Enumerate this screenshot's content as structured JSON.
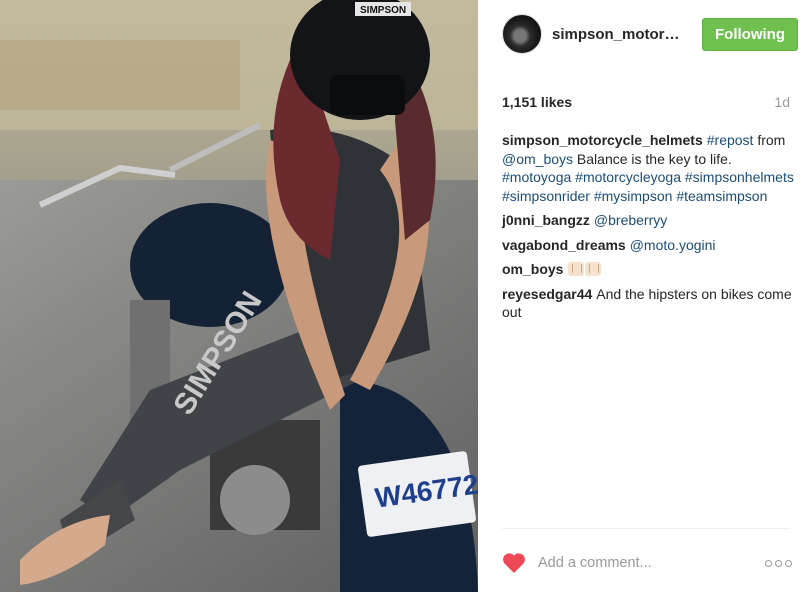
{
  "post": {
    "username": "simpson_motorc...",
    "follow_label": "Following",
    "likes": "1,151 likes",
    "age": "1d",
    "photo_lettering": {
      "helmet_brand": "SIMPSON",
      "plate_number": "W46772"
    }
  },
  "comments": [
    {
      "user": "simpson_motorcycle_helmets",
      "parts": [
        {
          "text": "#repost",
          "link": true
        },
        {
          "text": " from ",
          "link": false
        },
        {
          "text": "@om_boys",
          "link": true
        },
        {
          "text": " Balance is the key to life. ",
          "link": false
        },
        {
          "text": "#motoyoga",
          "link": true
        },
        {
          "text": " ",
          "link": false
        },
        {
          "text": "#motorcycleyoga",
          "link": true
        },
        {
          "text": " ",
          "link": false
        },
        {
          "text": "#simpsonhelmets",
          "link": true
        },
        {
          "text": " ",
          "link": false
        },
        {
          "text": "#simpsonrider",
          "link": true
        },
        {
          "text": " ",
          "link": false
        },
        {
          "text": "#mysimpson",
          "link": true
        },
        {
          "text": " ",
          "link": false
        },
        {
          "text": "#teamsimpson",
          "link": true
        }
      ]
    },
    {
      "user": "j0nni_bangzz",
      "parts": [
        {
          "text": "@breberryy",
          "link": true
        }
      ]
    },
    {
      "user": "vagabond_dreams",
      "parts": [
        {
          "text": "@moto.yogini",
          "link": true
        }
      ]
    },
    {
      "user": "om_boys",
      "parts": [],
      "emoji_count": 2
    },
    {
      "user": "reyesedgar44",
      "parts": [
        {
          "text": "And the hipsters on bikes come out",
          "link": false
        }
      ]
    }
  ],
  "footer": {
    "add_comment_placeholder": "Add a comment...",
    "heart_icon": "heart-icon",
    "more_icon": "more-options-icon"
  },
  "colors": {
    "follow_green": "#70c050",
    "link_blue": "#1b4d7a",
    "heart_red": "#ed4956"
  }
}
